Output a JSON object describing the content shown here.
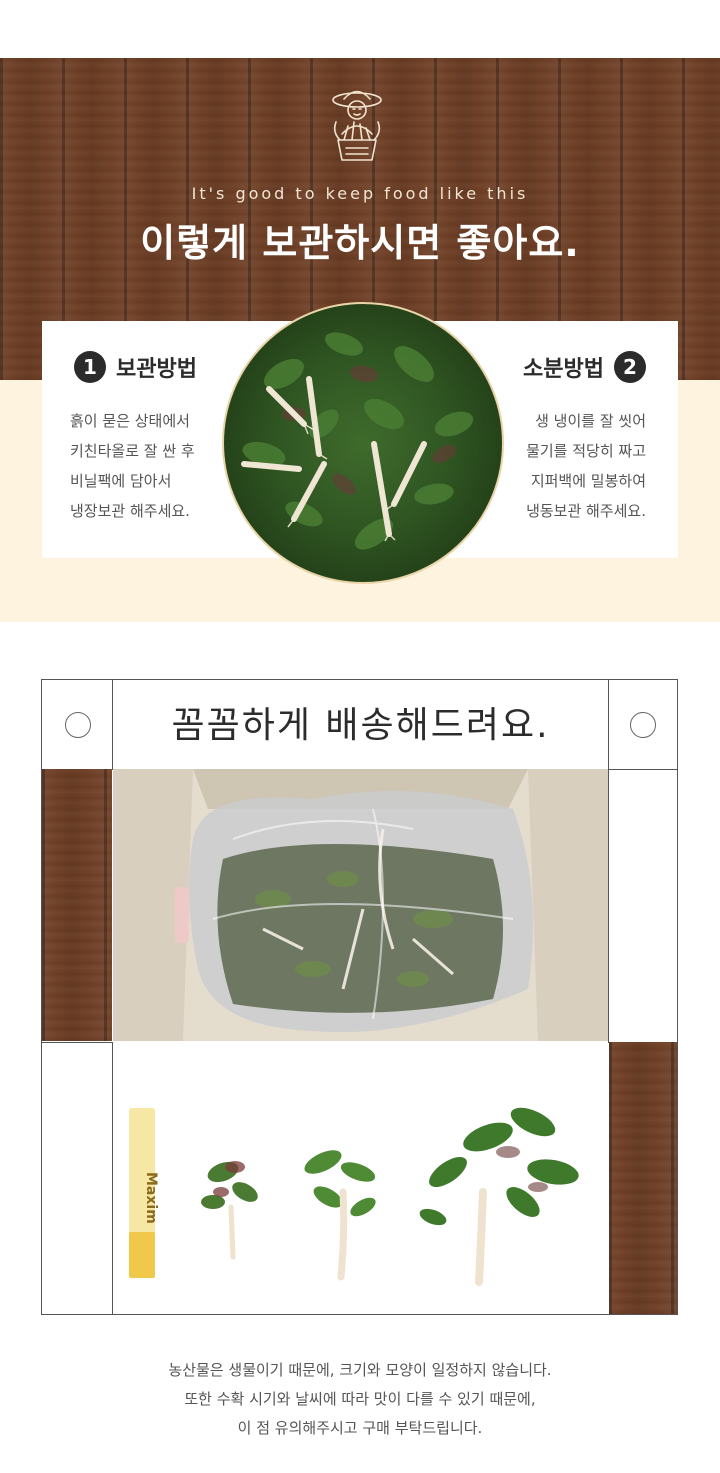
{
  "banner": {
    "subtitle": "It's good to keep food like this",
    "title": "이렇게 보관하시면 좋아요."
  },
  "storage": {
    "step1": {
      "number": "1",
      "title": "보관방법",
      "lines": [
        "흙이 묻은 상태에서",
        "키친타올로 잘 싼 후",
        "비닐팩에 담아서",
        "냉장보관 해주세요."
      ]
    },
    "step2": {
      "number": "2",
      "title": "소분방법",
      "lines": [
        "생 냉이를 잘 씻어",
        "물기를 적당히 짜고",
        "지퍼백에 밀봉하여",
        "냉동보관 해주세요."
      ]
    }
  },
  "delivery": {
    "title": "꼼꼼하게 배송해드려요.",
    "stick_label": "Maxim"
  },
  "note": {
    "lines": [
      "농산물은 생물이기 때문에, 크기와 모양이 일정하지 않습니다.",
      "또한 수확 시기와 날씨에 따라 맛이 다를 수 있기 때문에,",
      "이 점 유의해주시고 구매 부탁드립니다."
    ]
  },
  "colors": {
    "wood": "#6e3f26",
    "cream": "#fdf3df",
    "herb_green": "#2f5522",
    "root": "#efe6d4"
  }
}
